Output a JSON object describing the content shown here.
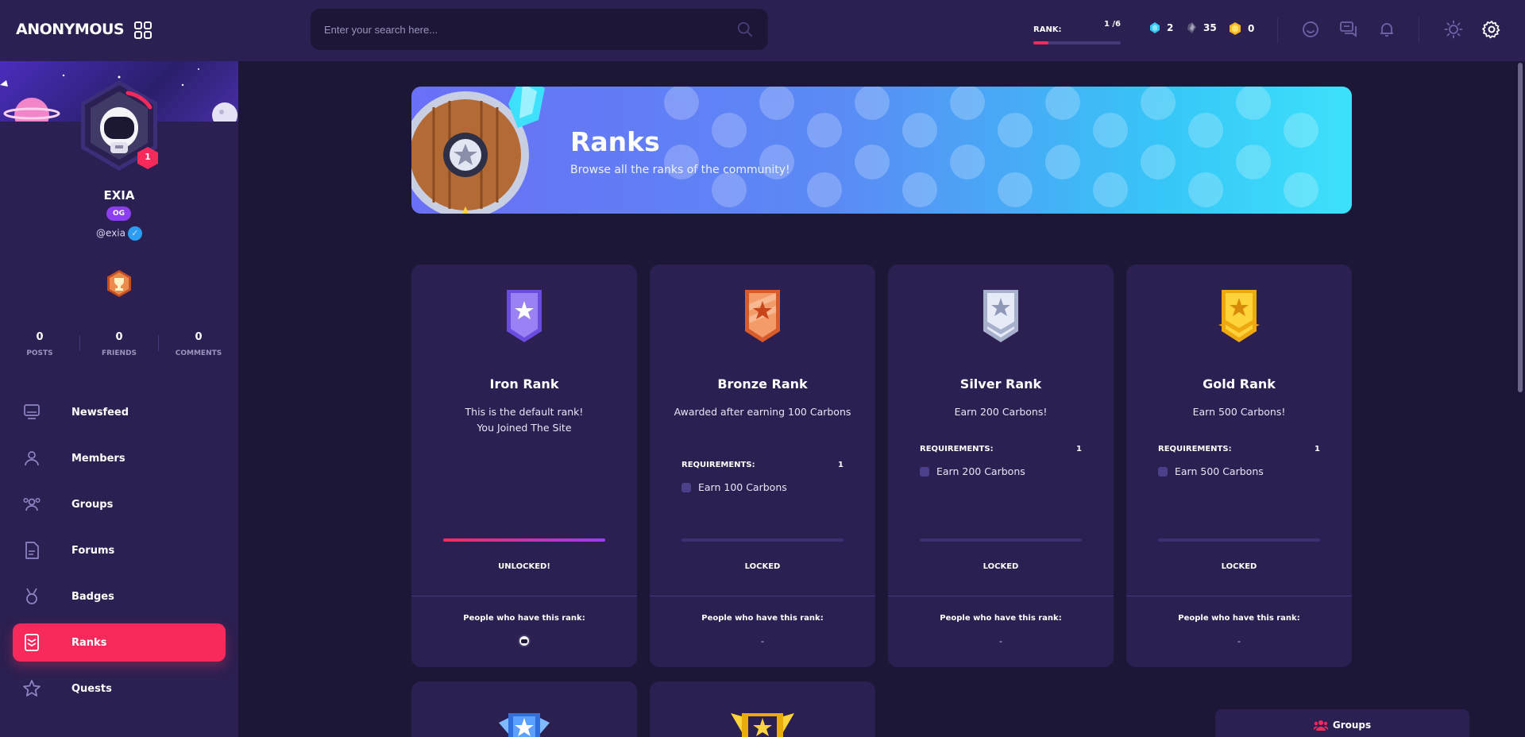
{
  "header": {
    "brand": "ANONYMOUS",
    "search_placeholder": "Enter your search here...",
    "rank_label": "RANK:",
    "rank_value": "1 /6",
    "rank_progress_fraction": 0.17,
    "stats": [
      {
        "icon": "blue-gem-icon",
        "value": "2"
      },
      {
        "icon": "dark-crystal-icon",
        "value": "35"
      },
      {
        "icon": "gold-coin-icon",
        "value": "0"
      }
    ]
  },
  "profile": {
    "name": "EXIA",
    "badge": "OG",
    "handle": "@exia",
    "level": "1",
    "counts": [
      {
        "value": "0",
        "label": "POSTS"
      },
      {
        "value": "0",
        "label": "FRIENDS"
      },
      {
        "value": "0",
        "label": "COMMENTS"
      }
    ]
  },
  "nav": {
    "items": [
      {
        "label": "Newsfeed"
      },
      {
        "label": "Members"
      },
      {
        "label": "Groups"
      },
      {
        "label": "Forums"
      },
      {
        "label": "Badges"
      },
      {
        "label": "Ranks"
      },
      {
        "label": "Quests"
      }
    ],
    "active_index": 5
  },
  "banner": {
    "title": "Ranks",
    "subtitle": "Browse all the ranks of the community!"
  },
  "colors": {
    "accent": "#f72a5b",
    "bg": "#1d1737",
    "panel": "#2b2051",
    "iron": "#8b6bf2",
    "bronze": "#f08a55",
    "silver": "#d5dbef",
    "gold": "#ffd43a"
  },
  "ranks": [
    {
      "name": "Iron Rank",
      "description": "This is the default rank!\nYou Joined The Site",
      "requirements_label": "",
      "requirements_count": "",
      "requirement": "",
      "progress_fraction": 1.0,
      "status": "UNLOCKED!",
      "people_label": "People who have this rank:",
      "people": ""
    },
    {
      "name": "Bronze Rank",
      "description": "Awarded after earning 100 Carbons",
      "requirements_label": "REQUIREMENTS:",
      "requirements_count": "1",
      "requirement": "Earn 100 Carbons",
      "progress_fraction": 0,
      "status": "LOCKED",
      "people_label": "People who have this rank:",
      "people": "-"
    },
    {
      "name": "Silver Rank",
      "description": "Earn 200 Carbons!",
      "requirements_label": "REQUIREMENTS:",
      "requirements_count": "1",
      "requirement": "Earn 200 Carbons",
      "progress_fraction": 0,
      "status": "LOCKED",
      "people_label": "People who have this rank:",
      "people": "-"
    },
    {
      "name": "Gold Rank",
      "description": "Earn 500 Carbons!",
      "requirements_label": "REQUIREMENTS:",
      "requirements_count": "1",
      "requirement": "Earn 500 Carbons",
      "progress_fraction": 0,
      "status": "LOCKED",
      "people_label": "People who have this rank:",
      "people": "-"
    }
  ],
  "floating_tab": {
    "label": "Groups"
  }
}
